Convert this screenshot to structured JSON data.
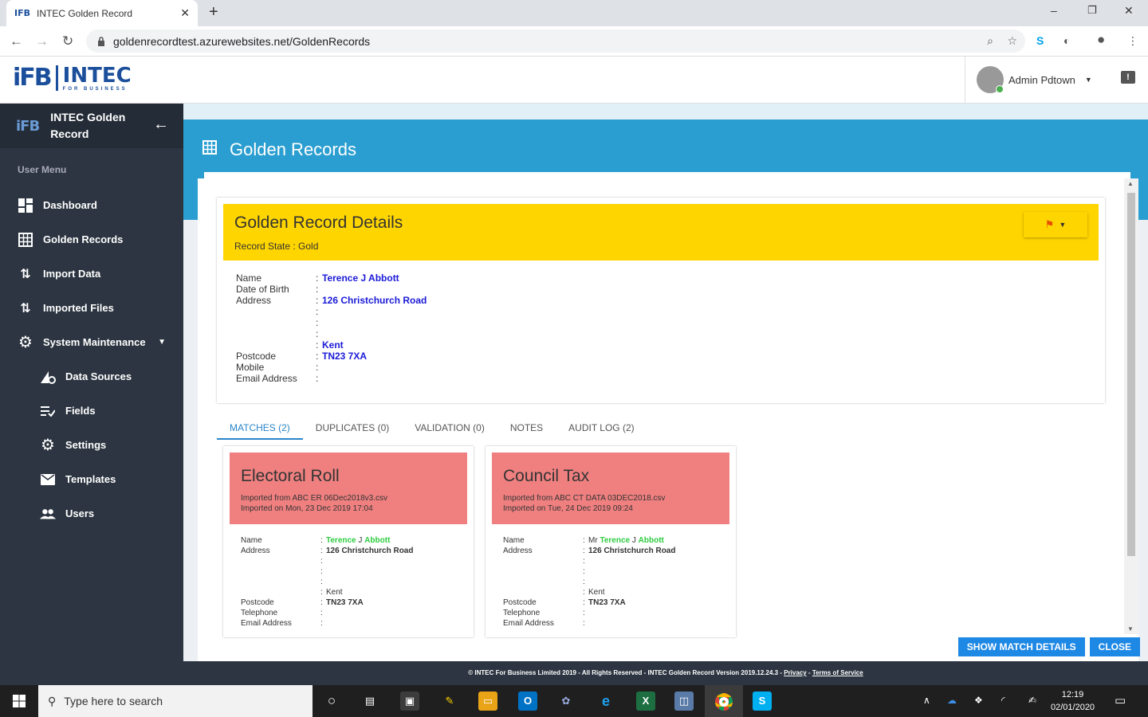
{
  "browser": {
    "tab_favicon": "IFB",
    "tab_title": "INTEC Golden Record",
    "url": "goldenrecordtest.azurewebsites.net/GoldenRecords",
    "new_tab": "+",
    "close_tab": "✕",
    "min": "–",
    "max": "❐",
    "close": "✕"
  },
  "header": {
    "logo_ifb": "iFB",
    "logo_intec": "INTEC",
    "logo_tag": "FOR BUSINESS",
    "user_name": "Admin Pdtown"
  },
  "sidebar": {
    "logo": "iFB",
    "app_name": "INTEC Golden Record",
    "section_label": "User Menu",
    "items": [
      {
        "label": "Dashboard",
        "icon": "dashboard-icon"
      },
      {
        "label": "Golden Records",
        "icon": "grid-icon"
      },
      {
        "label": "Import Data",
        "icon": "import-arrows-icon"
      },
      {
        "label": "Imported Files",
        "icon": "import-arrows-icon"
      },
      {
        "label": "System Maintenance",
        "icon": "gear-icon"
      }
    ],
    "sub_items": [
      {
        "label": "Data Sources",
        "icon": "data-source-icon"
      },
      {
        "label": "Fields",
        "icon": "fields-icon"
      },
      {
        "label": "Settings",
        "icon": "gear-icon"
      },
      {
        "label": "Templates",
        "icon": "envelope-icon"
      },
      {
        "label": "Users",
        "icon": "users-icon"
      }
    ]
  },
  "page": {
    "title": "Golden Records"
  },
  "details": {
    "title": "Golden Record Details",
    "record_state": "Record State : Gold",
    "fields": [
      {
        "label": "Name",
        "value": "Terence J Abbott"
      },
      {
        "label": "Date of Birth",
        "value": ""
      },
      {
        "label": "Address",
        "value": "126 Christchurch Road"
      },
      {
        "label": "",
        "value": ""
      },
      {
        "label": "",
        "value": ""
      },
      {
        "label": "",
        "value": ""
      },
      {
        "label": "",
        "value": "Kent"
      },
      {
        "label": "Postcode",
        "value": "TN23 7XA"
      },
      {
        "label": "Mobile",
        "value": ""
      },
      {
        "label": "Email Address",
        "value": ""
      }
    ]
  },
  "tabs": [
    {
      "label": "MATCHES (2)",
      "active": true
    },
    {
      "label": "DUPLICATES (0)",
      "active": false
    },
    {
      "label": "VALIDATION (0)",
      "active": false
    },
    {
      "label": "NOTES",
      "active": false
    },
    {
      "label": "AUDIT LOG (2)",
      "active": false
    }
  ],
  "matches": [
    {
      "title": "Electoral Roll",
      "imported_from": "Imported from ABC ER 06Dec2018v3.csv",
      "imported_on": "Imported on Mon, 23 Dec 2019 17:04",
      "name_prefix": "",
      "name_first": "Terence",
      "name_middle": "J",
      "name_last": "Abbott",
      "address": "126 Christchurch Road",
      "county": "Kent",
      "postcode": "TN23 7XA",
      "labels": {
        "name": "Name",
        "address": "Address",
        "postcode": "Postcode",
        "telephone": "Telephone",
        "email": "Email Address"
      }
    },
    {
      "title": "Council Tax",
      "imported_from": "Imported from ABC CT DATA 03DEC2018.csv",
      "imported_on": "Imported on Tue, 24 Dec 2019 09:24",
      "name_prefix": "Mr",
      "name_first": "Terence",
      "name_middle": "J",
      "name_last": "Abbott",
      "address": "126 Christchurch Road",
      "county": "Kent",
      "postcode": "TN23 7XA",
      "labels": {
        "name": "Name",
        "address": "Address",
        "postcode": "Postcode",
        "telephone": "Telephone",
        "email": "Email Address"
      }
    }
  ],
  "actions": {
    "show_match_details": "SHOW MATCH DETAILS",
    "close": "CLOSE"
  },
  "footer": {
    "text": "© INTEC For Business Limited 2019 - All Rights Reserved - INTEC Golden Record Version 2019.12.24.3 - ",
    "privacy": "Privacy",
    "dash": " - ",
    "terms": "Terms of Service"
  },
  "taskbar": {
    "search_placeholder": "Type here to search",
    "time": "12:19",
    "date": "02/01/2020"
  },
  "colors": {
    "sidebar_bg": "#2c3541",
    "banner": "#2a9ed0",
    "yellow": "#ffd500",
    "match_red": "#f08080",
    "accent": "#1e88e5"
  }
}
